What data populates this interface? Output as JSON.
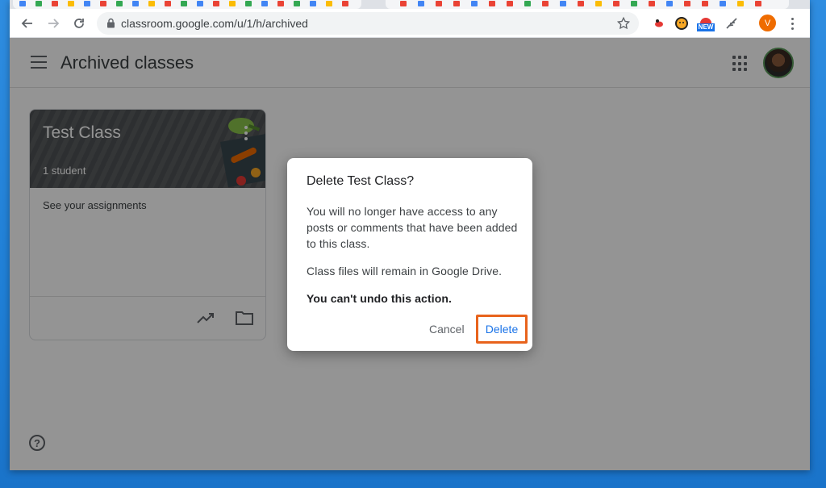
{
  "browser": {
    "url": "classroom.google.com/u/1/h/archived",
    "profile_initial": "V",
    "ext_badge_new": "NEW"
  },
  "header": {
    "title": "Archived classes"
  },
  "class_card": {
    "title": "Test Class",
    "subtitle": "1 student",
    "link": "See your assignments"
  },
  "help": {
    "glyph": "?"
  },
  "dialog": {
    "title": "Delete Test Class?",
    "paragraph1": "You will no longer have access to any posts or comments that have been added to this class.",
    "paragraph2": "Class files will remain in Google Drive.",
    "paragraph3": "You can't undo this action.",
    "cancel_label": "Cancel",
    "delete_label": "Delete"
  },
  "colors": {
    "accent": "#1a73e8",
    "highlight_box": "#e8631c",
    "profile": "#ef6c00"
  }
}
